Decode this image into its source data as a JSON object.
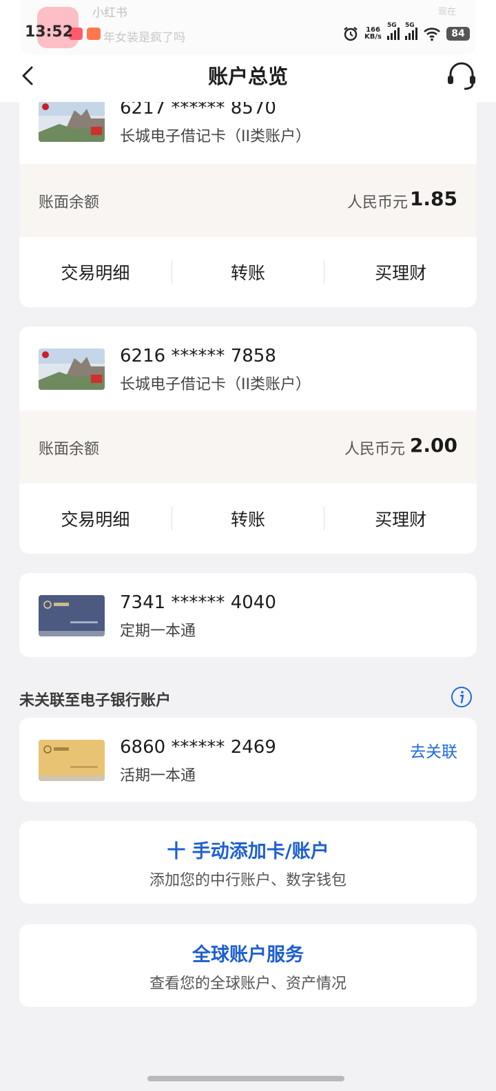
{
  "status_bar": {
    "time": "13:52",
    "net_speed_value": "166",
    "net_speed_unit": "KB/s",
    "signal1_label": "5G",
    "signal2_label": "5G",
    "battery": "84"
  },
  "notification": {
    "app_name": "小红书",
    "time": "现在",
    "text": "年女装是疯了吗"
  },
  "nav": {
    "title": "账户总览"
  },
  "cards": [
    {
      "number": "6217 ****** 8570",
      "type": "长城电子借记卡（II类账户）",
      "balance_label": "账面余额",
      "currency": "人民币元",
      "balance": "1.85",
      "actions": [
        "交易明细",
        "转账",
        "买理财"
      ]
    },
    {
      "number": "6216 ****** 7858",
      "type": "长城电子借记卡（II类账户）",
      "balance_label": "账面余额",
      "currency": "人民币元",
      "balance": "2.00",
      "actions": [
        "交易明细",
        "转账",
        "买理财"
      ]
    },
    {
      "number": "7341 ****** 4040",
      "type": "定期一本通"
    }
  ],
  "unlinked": {
    "section_title": "未关联至电子银行账户",
    "number": "6860 ****** 2469",
    "type": "活期一本通",
    "link_label": "去关联"
  },
  "add_account": {
    "title": "十 手动添加卡/账户",
    "subtitle": "添加您的中行账户、数字钱包"
  },
  "global": {
    "title": "全球账户服务",
    "subtitle": "查看您的全球账户、资产情况"
  },
  "colors": {
    "accent": "#1d6ae0",
    "balance_bg": "#f8f5f2",
    "page_bg": "#f2f2f4"
  }
}
